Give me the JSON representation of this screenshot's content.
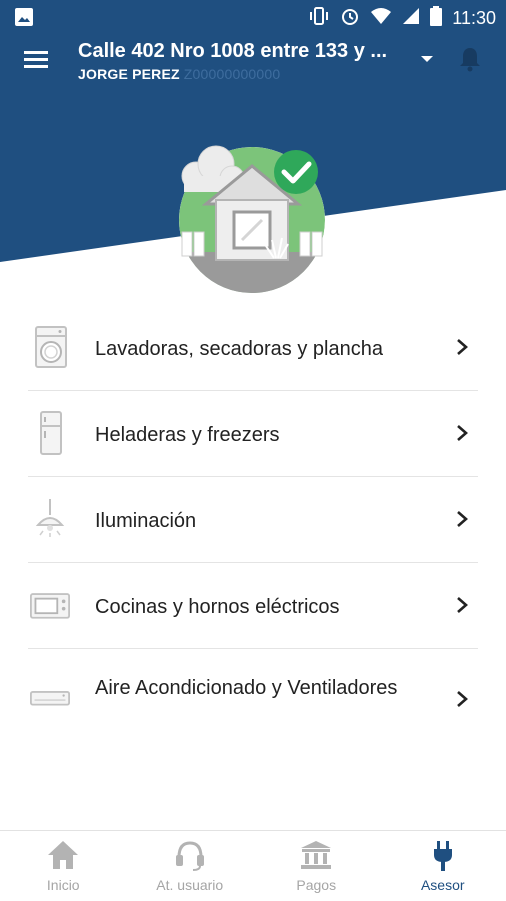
{
  "status_bar": {
    "time": "11:30"
  },
  "header": {
    "address": "Calle 402 Nro 1008 entre 133 y ...",
    "user_name": "JORGE PEREZ",
    "user_sub": "Z00000000000",
    "accent_color": "#1f4f80"
  },
  "categories": [
    {
      "label": "Lavadoras, secadoras y plancha",
      "icon": "washing-machine-icon"
    },
    {
      "label": "Heladeras y freezers",
      "icon": "fridge-icon"
    },
    {
      "label": "Iluminación",
      "icon": "lamp-icon"
    },
    {
      "label": "Cocinas y hornos eléctricos",
      "icon": "oven-icon"
    },
    {
      "label": "Aire Acondicionado y Ventiladores",
      "icon": "air-conditioner-icon"
    }
  ],
  "bottom_nav": {
    "items": [
      {
        "label": "Inicio",
        "icon": "home-icon"
      },
      {
        "label": "At. usuario",
        "icon": "headset-icon"
      },
      {
        "label": "Pagos",
        "icon": "bank-icon"
      },
      {
        "label": "Asesor",
        "icon": "plug-icon",
        "active": true
      }
    ]
  }
}
